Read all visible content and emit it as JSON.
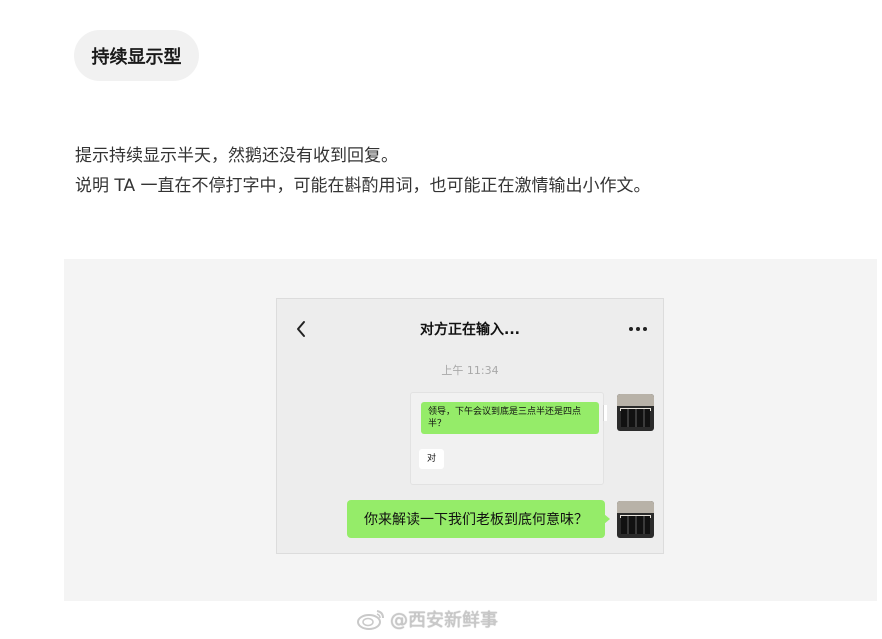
{
  "tag": {
    "label": "持续显示型"
  },
  "description": {
    "line1": "提示持续显示半天，然鹅还没有收到回复。",
    "line2": "说明 TA 一直在不停打字中，可能在斟酌用词，也可能正在激情输出小作文。"
  },
  "chat": {
    "back_icon": "chevron-left-icon",
    "title": "对方正在输入...",
    "more_icon": "more-dots-icon",
    "timestamp": "上午 11:34",
    "quoted_message": "领导，下午会议到底是三点半还是四点半？",
    "quoted_reply": "对",
    "main_message": "你来解读一下我们老板到底何意味？",
    "bubble_color": "#95ec69"
  },
  "watermark": {
    "text": "@西安新鲜事"
  }
}
